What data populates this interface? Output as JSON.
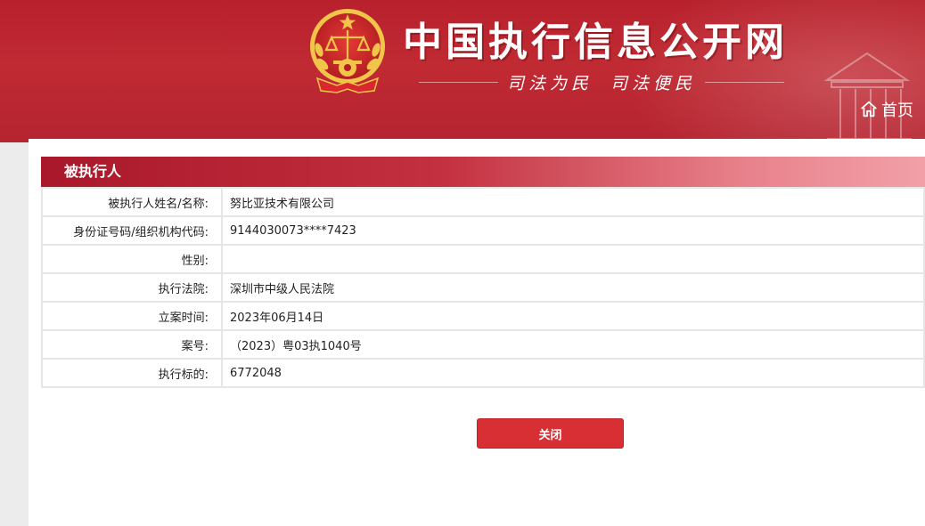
{
  "header": {
    "site_title": "中国执行信息公开网",
    "slogan_1": "司法为民",
    "slogan_2": "司法便民",
    "home_label": "首页"
  },
  "section": {
    "title": "被执行人"
  },
  "details": [
    {
      "label": "被执行人姓名/名称:",
      "value": "努比亚技术有限公司"
    },
    {
      "label": "身份证号码/组织机构代码:",
      "value": "9144030073****7423"
    },
    {
      "label": "性别:",
      "value": ""
    },
    {
      "label": "执行法院:",
      "value": "深圳市中级人民法院"
    },
    {
      "label": "立案时间:",
      "value": "2023年06月14日"
    },
    {
      "label": "案号:",
      "value": "（2023）粤03执1040号"
    },
    {
      "label": "执行标的:",
      "value": "6772048"
    }
  ],
  "actions": {
    "close_label": "关闭"
  },
  "colors": {
    "header_red": "#b8212c",
    "section_bar_start": "#a9182a",
    "section_bar_end": "#f2a0a8",
    "button_red": "#d72f34",
    "emblem_gold": "#f1c54a"
  },
  "icons": {
    "emblem": "national-emblem-icon",
    "home": "home-icon"
  }
}
